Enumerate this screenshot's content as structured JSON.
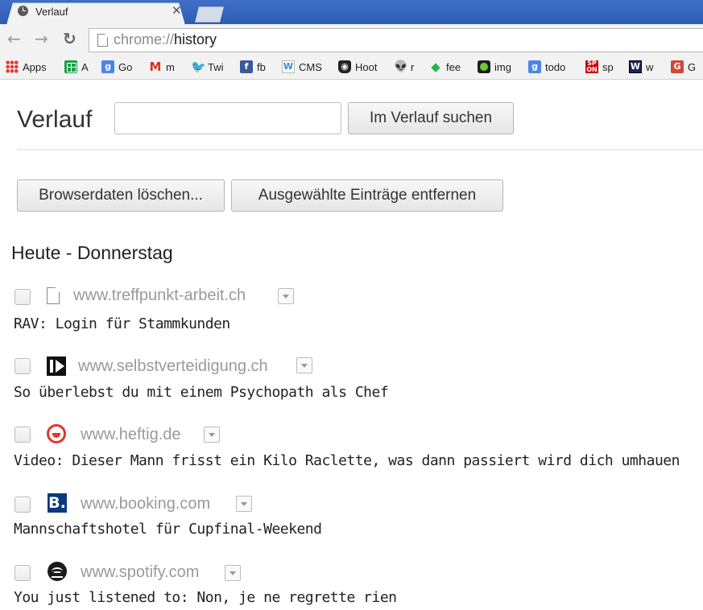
{
  "tab": {
    "title": "Verlauf",
    "close": "✕"
  },
  "omnibox": {
    "scheme": "chrome://",
    "host": "history"
  },
  "bookmarks": [
    {
      "label": "Apps",
      "icon": "apps-icon"
    },
    {
      "label": "A",
      "icon": "sheets-icon"
    },
    {
      "label": "Go",
      "icon": "google-icon"
    },
    {
      "label": "m",
      "icon": "gmail-icon"
    },
    {
      "label": "Twi",
      "icon": "twitter-icon"
    },
    {
      "label": "fb",
      "icon": "facebook-icon"
    },
    {
      "label": "CMS",
      "icon": "w-icon"
    },
    {
      "label": "Hoot",
      "icon": "hootsuite-icon"
    },
    {
      "label": "r",
      "icon": "reddit-icon"
    },
    {
      "label": "fee",
      "icon": "feedly-icon"
    },
    {
      "label": "img",
      "icon": "image-icon"
    },
    {
      "label": "todo",
      "icon": "google-icon"
    },
    {
      "label": "sp",
      "icon": "spon-icon"
    },
    {
      "label": "w",
      "icon": "w-icon"
    },
    {
      "label": "G",
      "icon": "google-red-icon"
    }
  ],
  "page": {
    "title": "Verlauf",
    "search_button": "Im Verlauf suchen",
    "clear_button": "Browserdaten löschen...",
    "remove_button": "Ausgewählte Einträge entfernen",
    "day_header": "Heute - Donnerstag"
  },
  "entries": [
    {
      "domain": "www.treffpunkt-arbeit.ch",
      "title": "RAV: Login für Stammkunden",
      "icon": "document-icon"
    },
    {
      "domain": "www.selbstverteidigung.ch",
      "title": "So überlebst du mit einem Psychopath als Chef",
      "icon": "selbstverteidigung-icon"
    },
    {
      "domain": "www.heftig.de",
      "title": "Video: Dieser Mann frisst ein Kilo Raclette, was dann passiert wird dich umhauen",
      "icon": "heftig-icon"
    },
    {
      "domain": "www.booking.com",
      "title": "Mannschaftshotel für Cupfinal-Weekend",
      "icon": "booking-icon",
      "glyph": "B."
    },
    {
      "domain": "www.spotify.com",
      "title": "You just listened to: Non, je ne regrette rien",
      "icon": "spotify-icon"
    }
  ]
}
